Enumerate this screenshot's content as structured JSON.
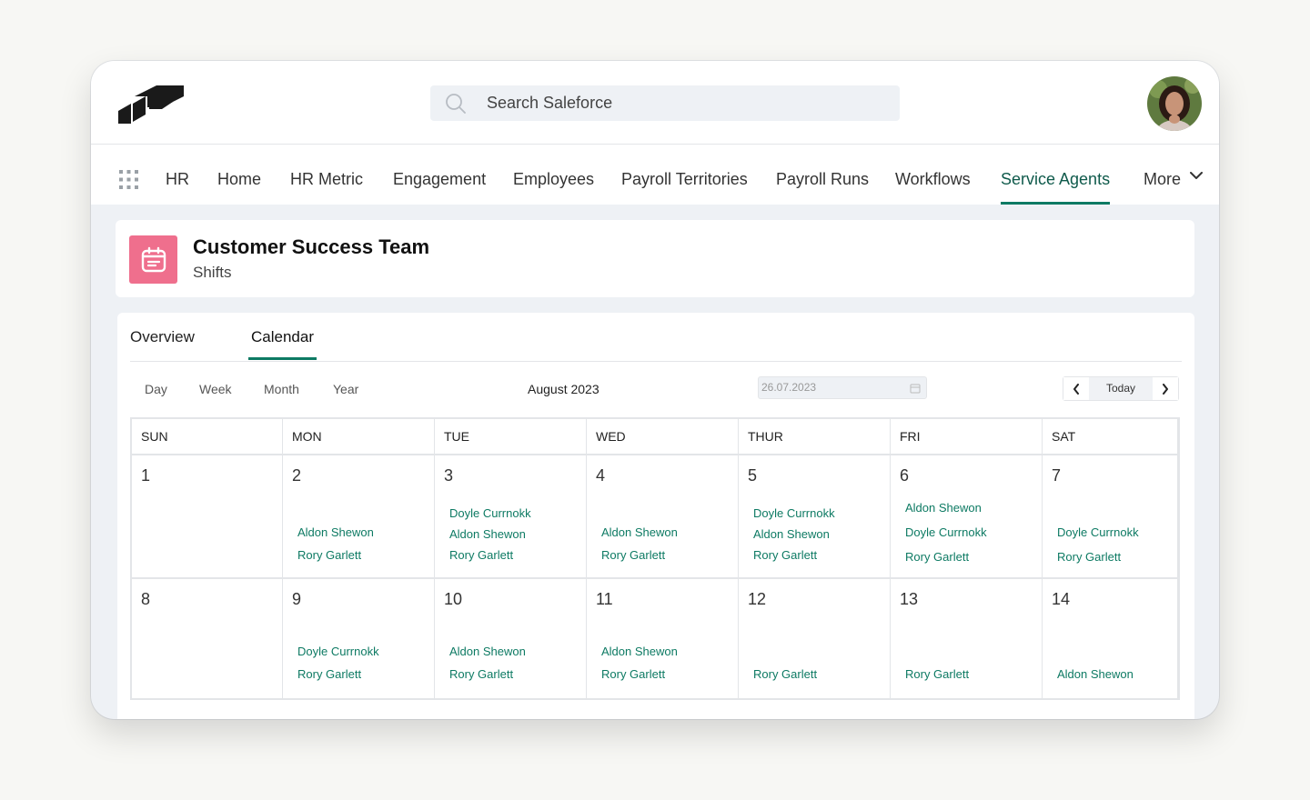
{
  "search": {
    "placeholder": "Search Saleforce"
  },
  "nav": {
    "items": [
      {
        "label": "HR",
        "active": false
      },
      {
        "label": "Home",
        "active": false
      },
      {
        "label": "HR Metric",
        "active": false
      },
      {
        "label": "Engagement",
        "active": false
      },
      {
        "label": "Employees",
        "active": false
      },
      {
        "label": "Payroll Territories",
        "active": false
      },
      {
        "label": "Payroll Runs",
        "active": false
      },
      {
        "label": "Workflows",
        "active": false
      },
      {
        "label": "Service Agents",
        "active": true
      },
      {
        "label": "More",
        "active": false
      }
    ]
  },
  "page": {
    "title": "Customer Success Team",
    "subtitle": "Shifts"
  },
  "tabs": [
    {
      "label": "Overview",
      "active": false
    },
    {
      "label": "Calendar",
      "active": true
    }
  ],
  "views": [
    "Day",
    "Week",
    "Month",
    "Year"
  ],
  "month_label": "August 2023",
  "date_input": {
    "value": "26.07.2023"
  },
  "today_label": "Today",
  "weekdays": [
    "SUN",
    "MON",
    "TUE",
    "WED",
    "THUR",
    "FRI",
    "SAT"
  ],
  "weeks": [
    {
      "days": [
        {
          "num": "1",
          "shifts": []
        },
        {
          "num": "2",
          "shifts": [
            "Aldon Shewon",
            "Rory Garlett"
          ]
        },
        {
          "num": "3",
          "shifts": [
            "Doyle Currnokk",
            "Aldon Shewon",
            "Rory Garlett"
          ]
        },
        {
          "num": "4",
          "shifts": [
            "Aldon Shewon",
            "Rory Garlett"
          ]
        },
        {
          "num": "5",
          "shifts": [
            "Doyle Currnokk",
            "Aldon Shewon",
            "Rory Garlett"
          ]
        },
        {
          "num": "6",
          "shifts": [
            "Aldon Shewon",
            "Doyle Currnokk",
            "Rory Garlett"
          ]
        },
        {
          "num": "7",
          "shifts": [
            "Doyle Currnokk",
            "Rory Garlett"
          ]
        }
      ]
    },
    {
      "days": [
        {
          "num": "8",
          "shifts": []
        },
        {
          "num": "9",
          "shifts": [
            "Doyle Currnokk",
            "Rory Garlett"
          ]
        },
        {
          "num": "10",
          "shifts": [
            "Aldon Shewon",
            "Rory Garlett"
          ]
        },
        {
          "num": "11",
          "shifts": [
            "Aldon Shewon",
            "Rory Garlett"
          ]
        },
        {
          "num": "12",
          "shifts": [
            "Rory Garlett"
          ]
        },
        {
          "num": "13",
          "shifts": [
            "Rory Garlett"
          ]
        },
        {
          "num": "14",
          "shifts": [
            "Aldon Shewon"
          ]
        }
      ]
    }
  ],
  "colors": {
    "accent": "#0d7a63",
    "page_icon": "#ef6f8d",
    "link": "#0d7a63"
  },
  "icons": {
    "logo": "salesforce-logo",
    "search": "search-icon",
    "app_launcher": "grid-icon",
    "page": "calendar-icon",
    "date": "calendar-small-icon",
    "prev": "chevron-left-icon",
    "next": "chevron-right-icon",
    "more": "chevron-down-icon"
  }
}
